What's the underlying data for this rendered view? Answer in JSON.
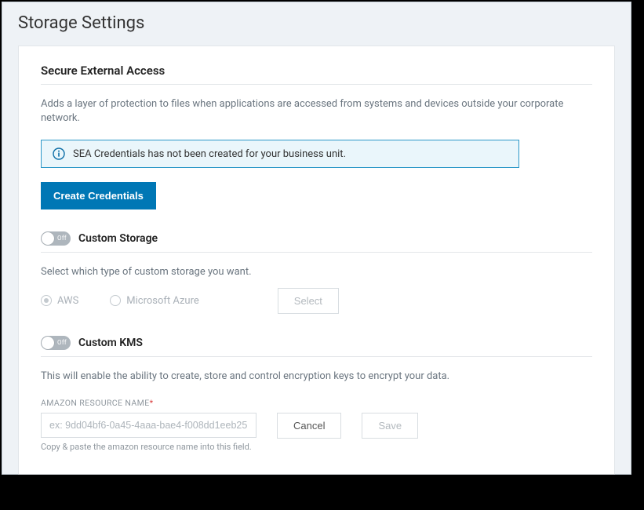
{
  "page_title": "Storage Settings",
  "sections": {
    "sea": {
      "heading": "Secure External Access",
      "description": "Adds a layer of protection to files when applications are accessed from systems and devices outside your corporate network.",
      "banner_text": "SEA Credentials has not been created for your business unit.",
      "create_button": "Create Credentials"
    },
    "custom_storage": {
      "heading": "Custom Storage",
      "toggle_state": "Off",
      "description": "Select which type of custom storage you want.",
      "option_aws": "AWS",
      "option_azure": "Microsoft Azure",
      "select_button": "Select"
    },
    "custom_kms": {
      "heading": "Custom KMS",
      "toggle_state": "Off",
      "description": "This will enable the ability to create, store and control encryption keys to encrypt your data.",
      "arn_label": "AMAZON RESOURCE NAME",
      "arn_placeholder": "ex: 9dd04bf6-0a45-4aaa-bae4-f008dd1eeb25",
      "arn_hint": "Copy & paste the amazon resource name into this field.",
      "cancel_button": "Cancel",
      "save_button": "Save"
    }
  }
}
